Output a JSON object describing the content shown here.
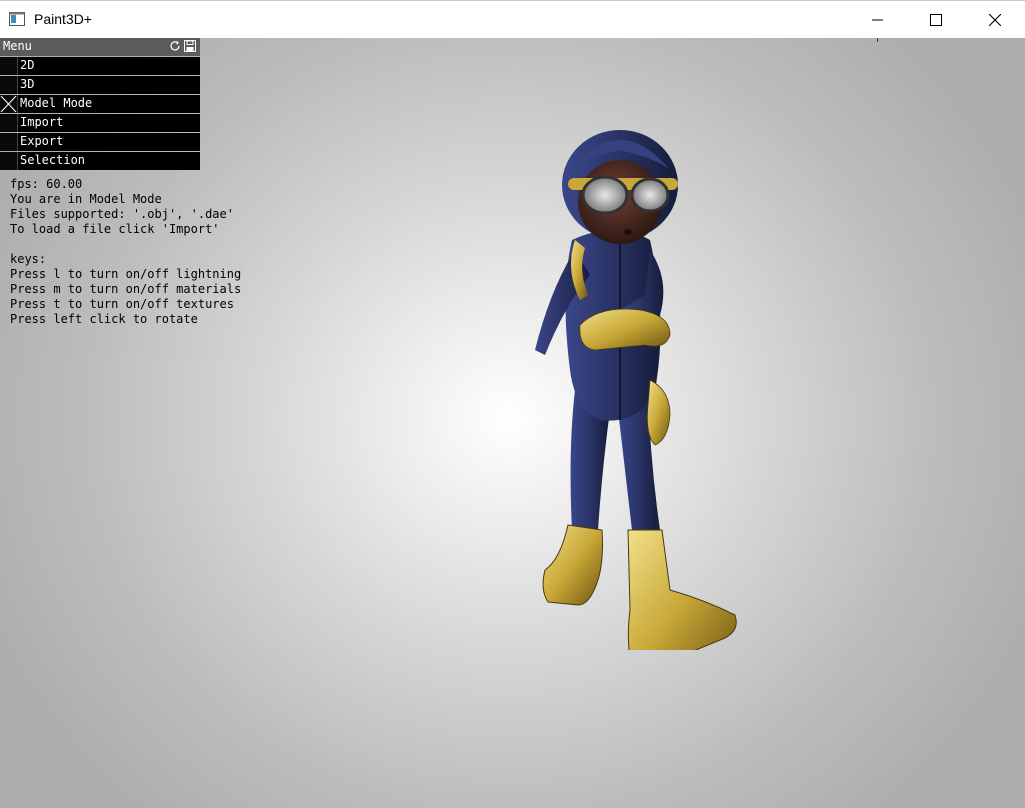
{
  "window": {
    "title": "Paint3D+",
    "controls": {
      "minimize": "minimize",
      "maximize": "maximize",
      "close": "close"
    }
  },
  "menu": {
    "title": "Menu",
    "items": [
      {
        "label": "2D",
        "checked": false
      },
      {
        "label": "3D",
        "checked": false
      },
      {
        "label": "Model Mode",
        "checked": true
      },
      {
        "label": "Import",
        "checked": false
      },
      {
        "label": "Export",
        "checked": false
      },
      {
        "label": "Selection",
        "checked": false
      }
    ]
  },
  "info": {
    "fps": "fps: 60.00",
    "mode": "You are in Model Mode",
    "formats": "Files supported: '.obj', '.dae'",
    "load_hint": "To load a file click 'Import'",
    "keys_heading": "keys:",
    "keys": [
      "Press l to turn on/off lightning",
      "Press m to turn on/off materials",
      "Press t to turn on/off textures",
      "Press left click to rotate"
    ]
  },
  "colors": {
    "suit": "#2a3366",
    "gold": "#c8a838",
    "skin": "#4a2a22"
  }
}
